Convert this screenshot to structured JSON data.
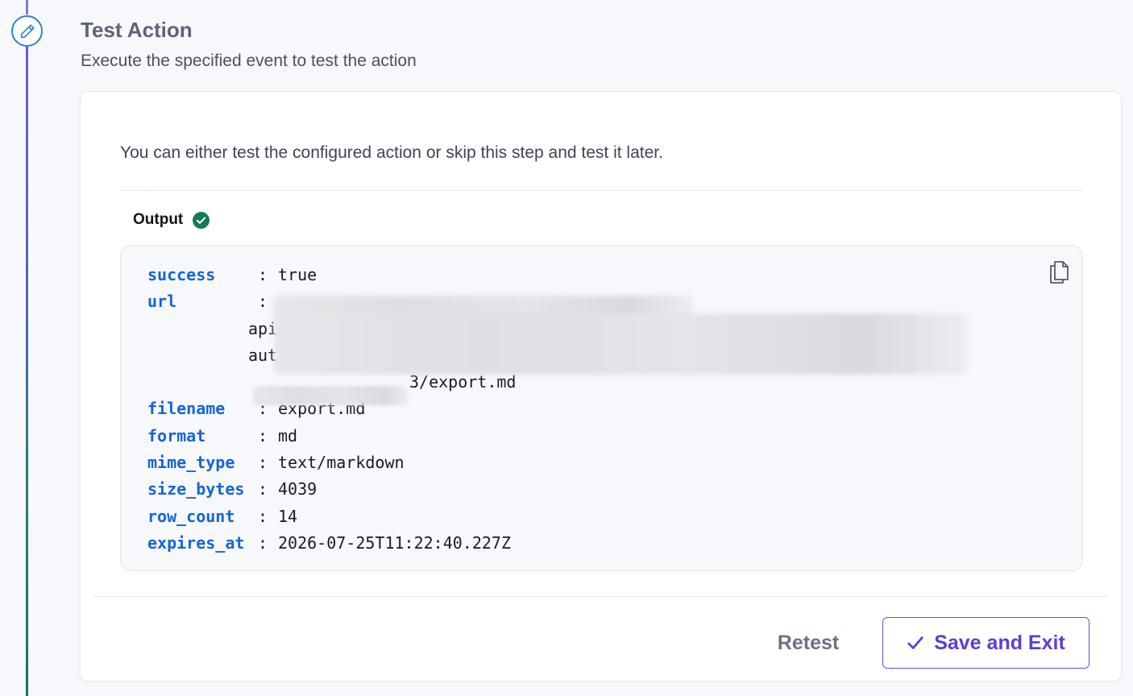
{
  "step": {
    "title": "Test Action",
    "subtitle": "Execute the specified event to test the action",
    "icon": "pencil-icon"
  },
  "card": {
    "intro": "You can either test the configured action or skip this step and test it later.",
    "output": {
      "label": "Output",
      "status_icon": "check-circle-icon",
      "copy_icon": "copy-icon",
      "fields": [
        {
          "key": "success",
          "value": "true"
        },
        {
          "key": "url",
          "value": ""
        },
        {
          "key": "filename",
          "value": "export.md"
        },
        {
          "key": "format",
          "value": "md"
        },
        {
          "key": "mime_type",
          "value": "text/markdown"
        },
        {
          "key": "size_bytes",
          "value": "4039"
        },
        {
          "key": "row_count",
          "value": "14"
        },
        {
          "key": "expires_at",
          "value": "2026-07-25T11:22:40.227Z"
        }
      ],
      "url_continuation": [
        "api",
        "aut",
        "3/export.md"
      ]
    }
  },
  "actions": {
    "retest_label": "Retest",
    "save_label": "Save and Exit"
  },
  "colors": {
    "accent": "#5b3fd6",
    "key": "#1565d8",
    "success": "#137a5a",
    "step_ring": "#2f7fd8"
  }
}
